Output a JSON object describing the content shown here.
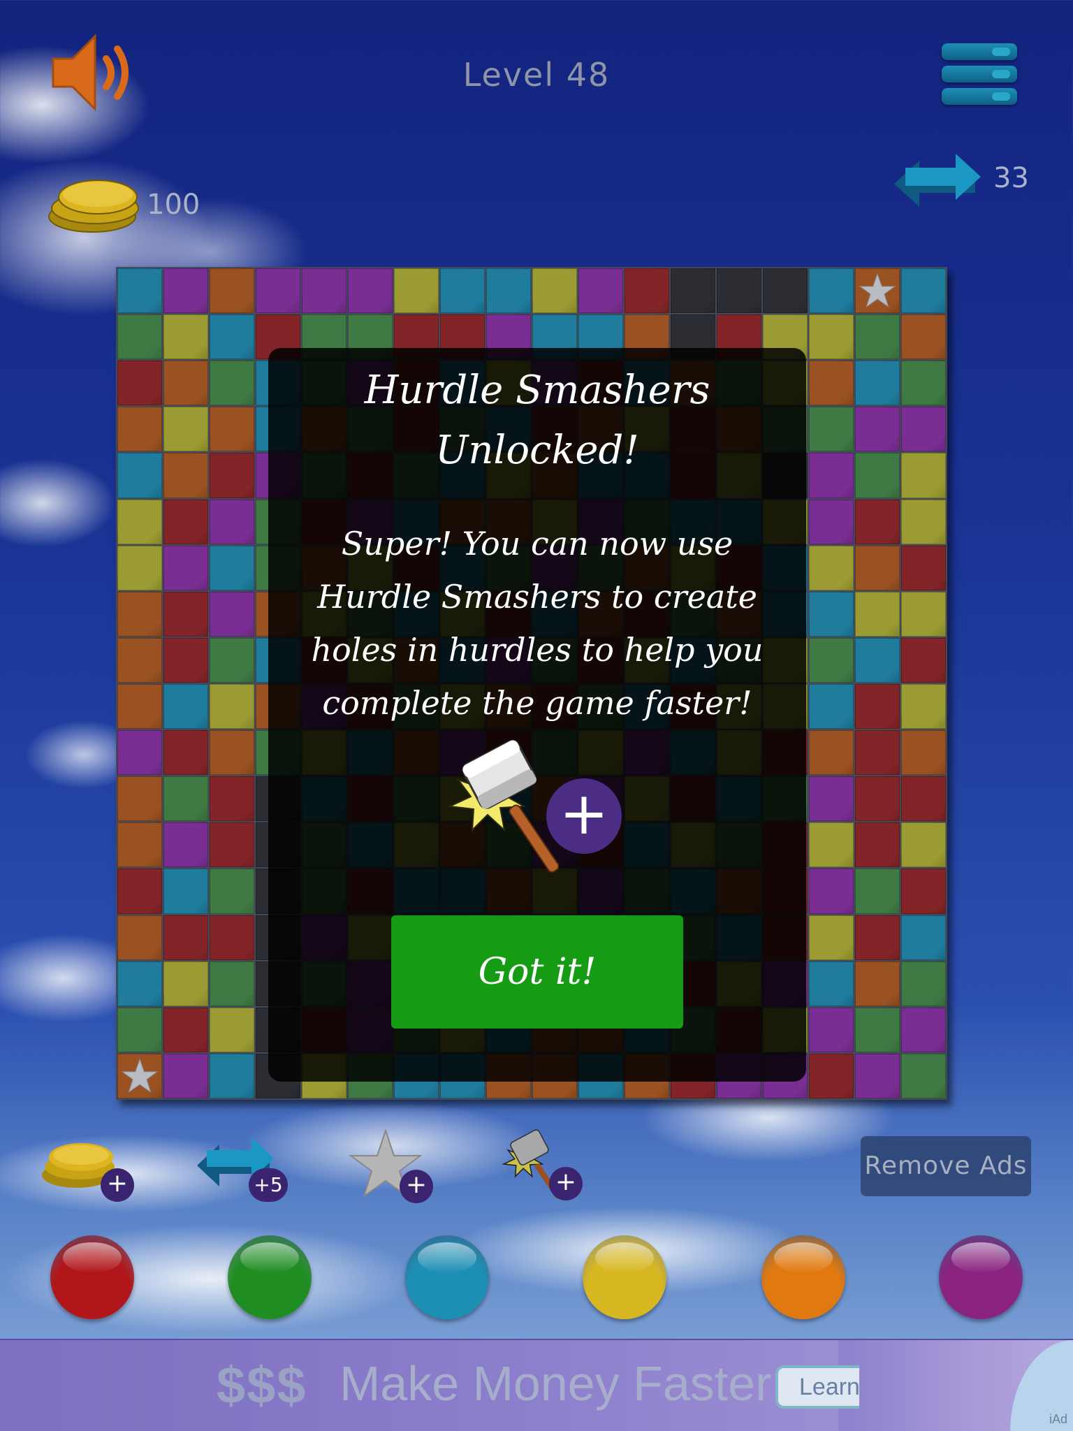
{
  "header": {
    "level_title": "Level 48",
    "sound_icon": "speaker-icon",
    "menu_icon": "menu-icon"
  },
  "stats": {
    "coins": "100",
    "swaps": "33"
  },
  "board": {
    "rows": 18,
    "cols": 18,
    "palette": {
      "B": "#1f7c9c",
      "P": "#7a2e93",
      "O": "#9a5222",
      "Y": "#9b9b33",
      "G": "#3f7a44",
      "R": "#832528",
      "K": "#2b2d33"
    },
    "cells": [
      "BPOPPPYBBYPRKKKBOB",
      "GYBRGGRRPBBOKRYYGO",
      "ROGBGPRBYPRBOGYOBG",
      "OYOBOGRGBROYROGGPP",
      "BORPGRGBYOBBRYKPGY",
      "YRPGRPBOOYPGBBYPRY",
      "YPBGOYRBGPGOYRBYOR",
      "ORPOYGBYRBORGOBBYY",
      "ORGBRYOBPGRYBGYGBR",
      "OBYOPRGYORGBRYYBRY",
      "PROGYBOPRGYPBYRORO",
      "OGRKBRGYBOPYRBGPRR",
      "OPRKGBYOGPRBYGRYRY",
      "RBGKGRBBOYPGBORPGR",
      "ORRKPYBRYGBOGBRYRB",
      "BYGKGPRBOYBGRYPBOG",
      "GRYKRPGYBOOBGRYPGP",
      "OPBKYGBBOOBORPPRPG"
    ],
    "stars": [
      [
        0,
        16
      ],
      [
        17,
        0
      ]
    ],
    "star_icon": "star-icon"
  },
  "modal": {
    "title_line1": "Hurdle Smashers",
    "title_line2": "Unlocked!",
    "body_line1": "Super!  You can now use",
    "body_line2": "Hurdle Smashers to create",
    "body_line3": "holes in hurdles to help you",
    "body_line4": "complete the game faster!",
    "hammer_icon": "hammer-icon",
    "plus_symbol": "+",
    "button_label": "Got it!"
  },
  "powerups": [
    {
      "icon": "coins-icon",
      "badge": "+"
    },
    {
      "icon": "swap-arrows-icon",
      "badge": "+5"
    },
    {
      "icon": "star-icon",
      "badge": "+"
    },
    {
      "icon": "hammer-icon",
      "badge": "+"
    }
  ],
  "remove_ads_label": "Remove Ads",
  "color_balls": [
    {
      "name": "red",
      "color": "#b0161a"
    },
    {
      "name": "green",
      "color": "#1f8d22"
    },
    {
      "name": "blue",
      "color": "#1e8fb4"
    },
    {
      "name": "yellow",
      "color": "#d6b722"
    },
    {
      "name": "orange",
      "color": "#e07a10"
    },
    {
      "name": "purple",
      "color": "#8a237f"
    }
  ],
  "ad": {
    "dollar_text": "$$$",
    "headline": "Make Money Faster",
    "learn_label": "Learn",
    "iad_label": "iAd"
  }
}
